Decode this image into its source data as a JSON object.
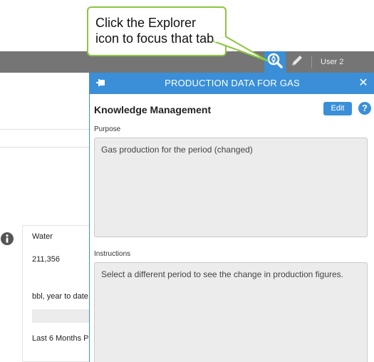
{
  "callout": {
    "text": "Click the Explorer icon to focus that tab"
  },
  "toolbar": {
    "explorer_icon": "explorer-search-icon",
    "pencil_icon": "pencil-icon",
    "user_label": "User 2",
    "bar_color": "#757575",
    "active_color": "#3a8fd8"
  },
  "background_card": {
    "title": "Water",
    "value": "211,356",
    "unit": "bbl, year to date",
    "footer": "Last 6 Months Pr"
  },
  "panel": {
    "title": "PRODUCTION DATA FOR GAS",
    "pin_icon": "pin-icon",
    "close_icon": "close-icon",
    "heading": "Knowledge Management",
    "edit_label": "Edit",
    "help_label": "?",
    "purpose_label": "Purpose",
    "purpose_text": "Gas production for the period (changed)",
    "instructions_label": "Instructions",
    "instructions_text": "Select a different period to see the change in production figures."
  }
}
